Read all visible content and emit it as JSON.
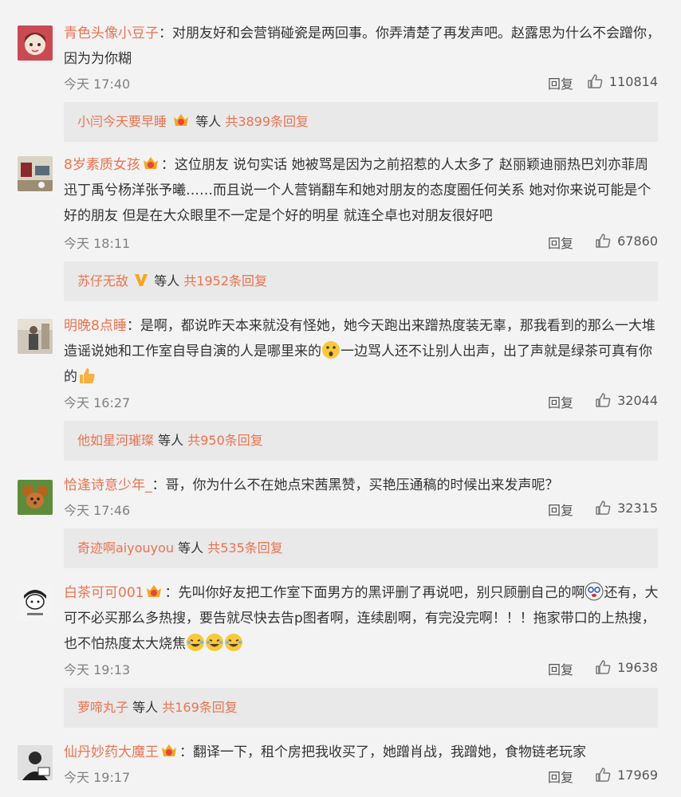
{
  "ui": {
    "time_prefix": "今天",
    "reply_label": "回复",
    "reply_people": "等人"
  },
  "comments": [
    {
      "user": "青色头像小豆子",
      "text": "：对朋友好和会营销碰瓷是两回事。你弄清楚了再发声吧。赵露思为什么不会蹭你，因为为你糊",
      "time": "17:40",
      "likes": "110814",
      "reply": {
        "user": "小闫今天要早睡",
        "total": "共3899条回复"
      },
      "avatar_icon": "cartoon-girl-avatar"
    },
    {
      "user": "8岁素质女孩",
      "text": "：这位朋友  说句实话  她被骂是因为之前招惹的人太多了  赵丽颖迪丽热巴刘亦菲周迅丁禹兮杨洋张予曦……而且说一个人营销翻车和她对朋友的态度圈任何关系  她对你来说可能是个好的朋友  但是在大众眼里不一定是个好的明星  就连仝卓也对朋友很好吧",
      "time": "18:11",
      "likes": "67860",
      "reply": {
        "user": "苏仔无敌",
        "total": "共1952条回复"
      },
      "avatar_icon": "room-photo-avatar"
    },
    {
      "user": "明晚8点睡",
      "text_a": "：是啊，都说昨天本来就没有怪她，她今天跑出来蹭热度装无辜，那我看到的那么一大堆造谣说她和工作室自导自演的人是哪里来的",
      "text_b": "一边骂人还不让别人出声，出了声就是绿茶可真有你的",
      "time": "16:27",
      "likes": "32044",
      "reply": {
        "user": "他如星河璀璨",
        "total": "共950条回复"
      },
      "avatar_icon": "person-photo-avatar"
    },
    {
      "user": "恰逢诗意少年_",
      "text": "：哥，你为什么不在她点宋茜黑赞，买艳压通稿的时候出来发声呢？",
      "time": "17:46",
      "likes": "32315",
      "reply": {
        "user": "奇迹啊aiyouyou",
        "total": "共535条回复"
      },
      "avatar_icon": "cartoon-mouse-avatar"
    },
    {
      "user": "白茶可可001",
      "text_a": "：先叫你好友把工作室下面男方的黑评删了再说吧，别只顾删自己的啊",
      "text_b": "还有，大可不必买那么多热搜，要告就尽快去告p图者啊，连续剧啊，有完没完啊！！！拖家带口的上热搜，也不怕热度太大烧焦",
      "time": "19:13",
      "likes": "19638",
      "reply": {
        "user": "萝啼丸子",
        "total": "共169条回复"
      },
      "avatar_icon": "cartoon-character-avatar"
    },
    {
      "user": "仙丹妙药大魔王",
      "text": "：翻译一下，租个房把我收买了，她蹭肖战，我蹭她，食物链老玩家",
      "time": "19:17",
      "likes": "17969",
      "avatar_icon": "person-dark-avatar"
    }
  ]
}
